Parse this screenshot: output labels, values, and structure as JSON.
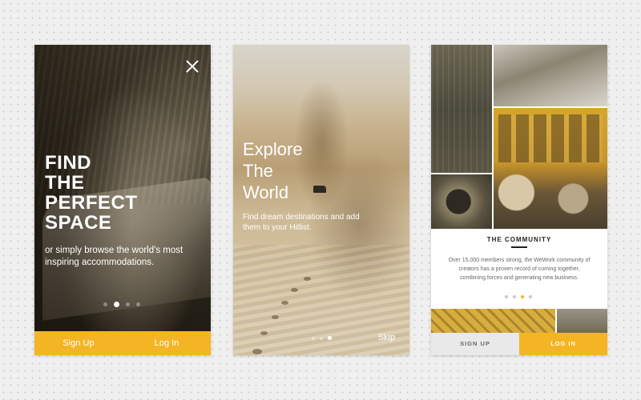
{
  "screen1": {
    "headline": [
      "FIND",
      "THE",
      "PERFECT",
      "SPACE"
    ],
    "subtitle": "or simply browse the world's most inspiring accommodations.",
    "close_icon": "close-icon",
    "pagination": {
      "count": 4,
      "active": 1
    },
    "signup_label": "Sign Up",
    "login_label": "Log In",
    "accent": "#f3b523"
  },
  "screen2": {
    "title": [
      "Explore",
      "The",
      "World"
    ],
    "subtitle": "Find dream destinations and add them to your Hitlist.",
    "pagination": {
      "count": 3,
      "active": 2
    },
    "skip_label": "Skip"
  },
  "screen3": {
    "heading": "THE COMMUNITY",
    "body": "Over 15,000 members strong, the WeWork community of creators has a proven record of coming together, combining forces and generating new business.",
    "pagination": {
      "count": 4,
      "active": 2
    },
    "signup_label": "SIGN UP",
    "login_label": "LOG IN",
    "accent": "#f3b523"
  }
}
